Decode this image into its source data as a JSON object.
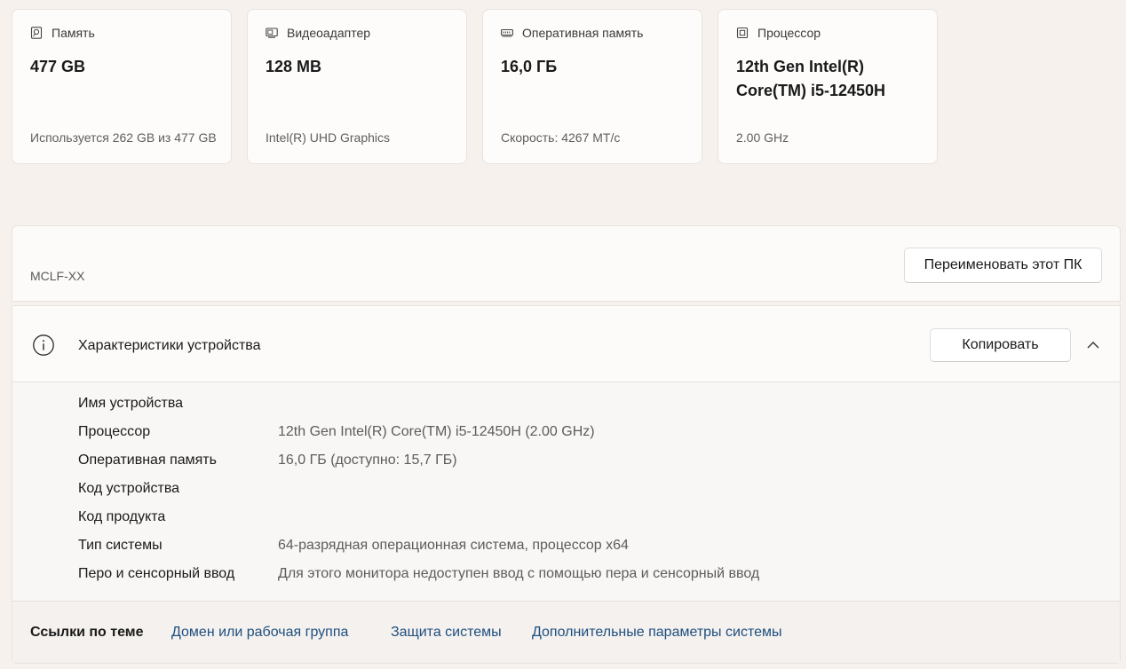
{
  "cards": [
    {
      "title": "Память",
      "icon": "storage-icon",
      "value": "477 GB",
      "sub": "Используется 262 GB из 477 GB"
    },
    {
      "title": "Видеоадаптер",
      "icon": "display-adapter-icon",
      "value": "128 MB",
      "sub": "Intel(R) UHD Graphics"
    },
    {
      "title": "Оперативная память",
      "icon": "ram-icon",
      "value": "16,0 ГБ",
      "sub": "Скорость: 4267 МТ/с"
    },
    {
      "title": "Процессор",
      "icon": "cpu-icon",
      "value": "12th Gen Intel(R) Core(TM) i5-12450H",
      "sub": "2.00 GHz"
    }
  ],
  "pc": {
    "name": "MCLF-XX",
    "rename_label": "Переименовать этот ПК"
  },
  "specs": {
    "title": "Характеристики устройства",
    "copy_label": "Копировать",
    "rows": [
      {
        "label": "Имя устройства",
        "value": ""
      },
      {
        "label": "Процессор",
        "value": "12th Gen Intel(R) Core(TM) i5-12450H (2.00 GHz)"
      },
      {
        "label": "Оперативная память",
        "value": "16,0 ГБ (доступно: 15,7 ГБ)"
      },
      {
        "label": "Код устройства",
        "value": ""
      },
      {
        "label": "Код продукта",
        "value": ""
      },
      {
        "label": "Тип системы",
        "value": "64-разрядная операционная система, процессор x64"
      },
      {
        "label": "Перо и сенсорный ввод",
        "value": "Для этого монитора недоступен ввод с помощью пера и сенсорный ввод"
      }
    ]
  },
  "links": {
    "title": "Ссылки по теме",
    "items": [
      "Домен или рабочая группа",
      "Защита системы",
      "Дополнительные параметры системы"
    ]
  },
  "colors": {
    "background": "#f6f1ec",
    "card": "#fdfcfb",
    "link": "#1f4f80",
    "secondary_text": "#5c5c5c"
  }
}
